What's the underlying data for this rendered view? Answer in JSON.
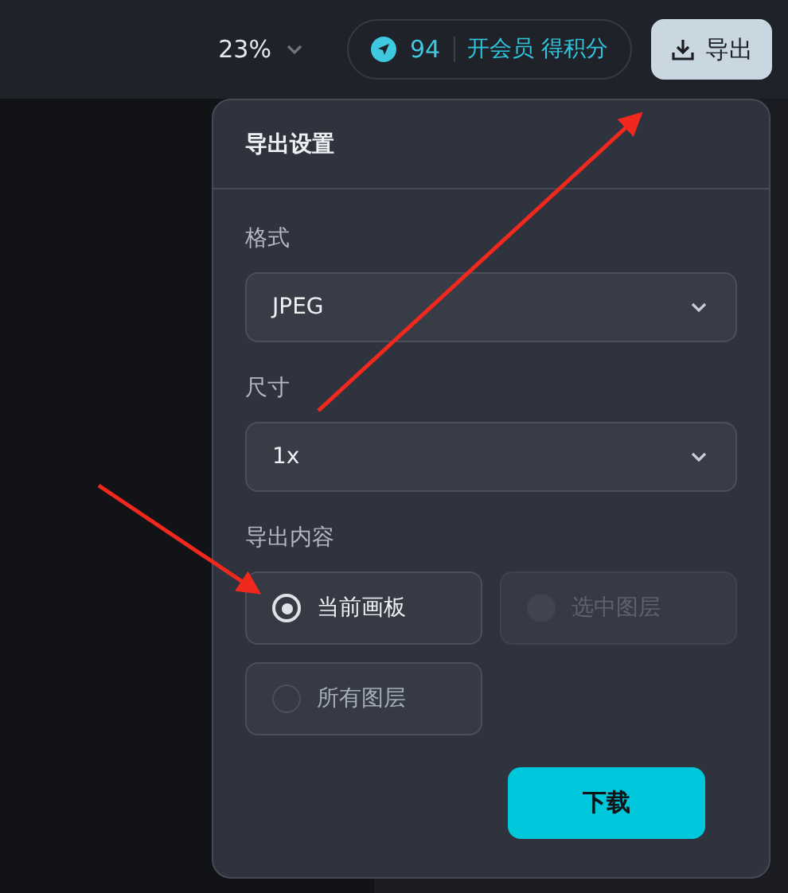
{
  "toolbar": {
    "zoom": "23%",
    "points": "94",
    "member_link": "开会员 得积分",
    "export_button": "导出"
  },
  "export_panel": {
    "title": "导出设置",
    "fields": [
      {
        "label": "格式",
        "value": "JPEG"
      },
      {
        "label": "尺寸",
        "value": "1x"
      }
    ],
    "content_label": "导出内容",
    "options": [
      {
        "label": "当前画板",
        "selected": true,
        "disabled": false
      },
      {
        "label": "选中图层",
        "selected": false,
        "disabled": true
      },
      {
        "label": "所有图层",
        "selected": false,
        "disabled": false
      }
    ],
    "download_button": "下载"
  }
}
